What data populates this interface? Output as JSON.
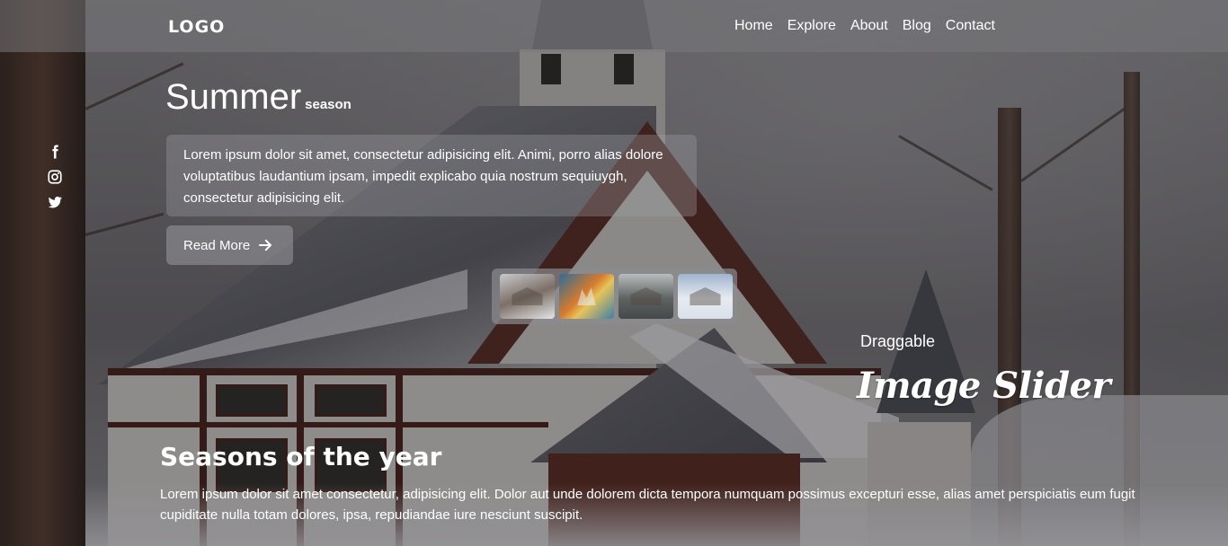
{
  "navbar": {
    "logo": "LOGO",
    "links": [
      "Home",
      "Explore",
      "About",
      "Blog",
      "Contact"
    ]
  },
  "social": {
    "icons": [
      "facebook-icon",
      "instagram-icon",
      "twitter-icon"
    ]
  },
  "hero": {
    "title": "Summer",
    "subtitle": "season",
    "text": "Lorem ipsum dolor sit amet, consectetur adipisicing elit. Animi, porro alias dolore voluptatibus laudantium ipsam, impedit explicabo quia nostrum sequiuygh, consectetur adipisicing elit.",
    "button_label": "Read More",
    "button_icon": "arrow-right-icon"
  },
  "thumbnails": {
    "count": 4
  },
  "slider": {
    "label": "Draggable",
    "title": "Image Slider"
  },
  "seasons": {
    "title": "Seasons of the year",
    "text": "Lorem ipsum dolor sit amet consectetur, adipisicing elit. Dolor aut unde dolorem dicta tempora numquam possimus excepturi esse, alias amet perspiciatis eum fugit cupiditate nulla totam dolores, ipsa, repudiandae iure nesciunt suscipit."
  },
  "colors": {
    "text": "#ffffff",
    "navbar_overlay": "#78787c"
  }
}
